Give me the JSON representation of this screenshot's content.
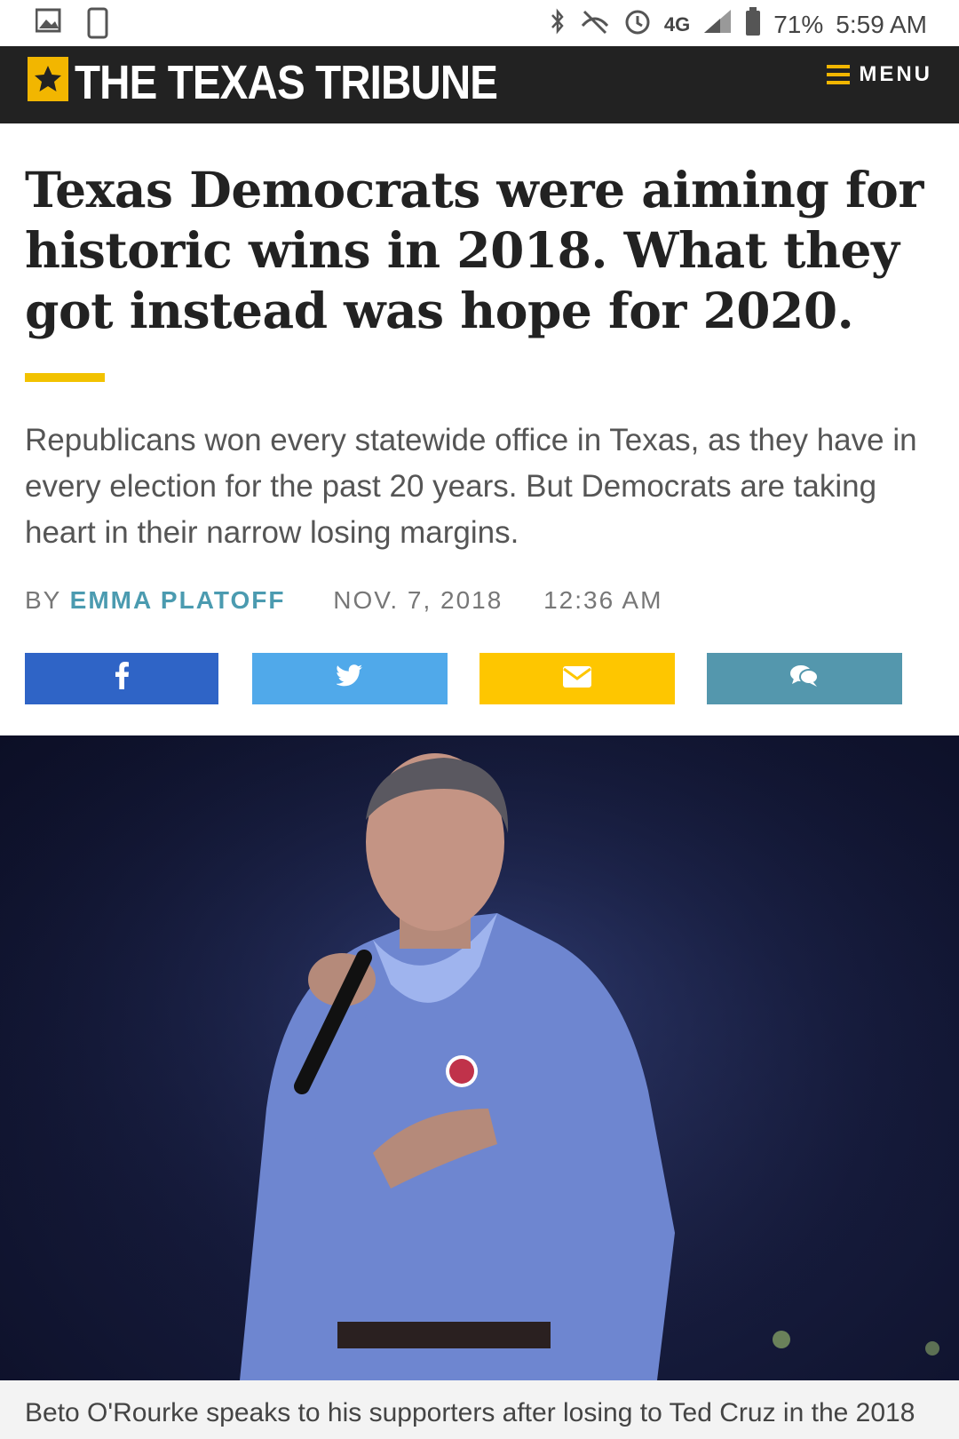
{
  "status_bar": {
    "left_icons": [
      "image-icon",
      "screenshot-icon"
    ],
    "right_icons": [
      "bluetooth-icon",
      "mute-icon",
      "alarm-icon",
      "lte-icon",
      "signal-icon",
      "battery-icon"
    ],
    "network": "4G",
    "battery": "71%",
    "time": "5:59 AM"
  },
  "header": {
    "logo_text": "THE TEXAS TRIBUNE",
    "menu_label": "MENU",
    "brand_color": "#f2b600"
  },
  "article": {
    "headline": "Texas Democrats were aiming for historic wins in 2018. What they got instead was hope for 2020.",
    "dek": "Republicans won every statewide office in Texas, as they have in every election for the past 20 years. But Democrats are taking heart in their narrow losing margins.",
    "byline_prefix": "BY",
    "author": "EMMA PLATOFF",
    "date": "NOV. 7, 2018",
    "time": "12:36 AM"
  },
  "share_buttons": [
    {
      "name": "facebook",
      "icon": "facebook-icon",
      "color": "#2f64c6"
    },
    {
      "name": "twitter",
      "icon": "twitter-icon",
      "color": "#50a9ea"
    },
    {
      "name": "email",
      "icon": "envelope-icon",
      "color": "#fec600"
    },
    {
      "name": "comments",
      "icon": "comments-icon",
      "color": "#5497ad"
    }
  ],
  "photo": {
    "caption": "Beto O'Rourke speaks to his supporters after losing to Ted Cruz in the 2018"
  }
}
